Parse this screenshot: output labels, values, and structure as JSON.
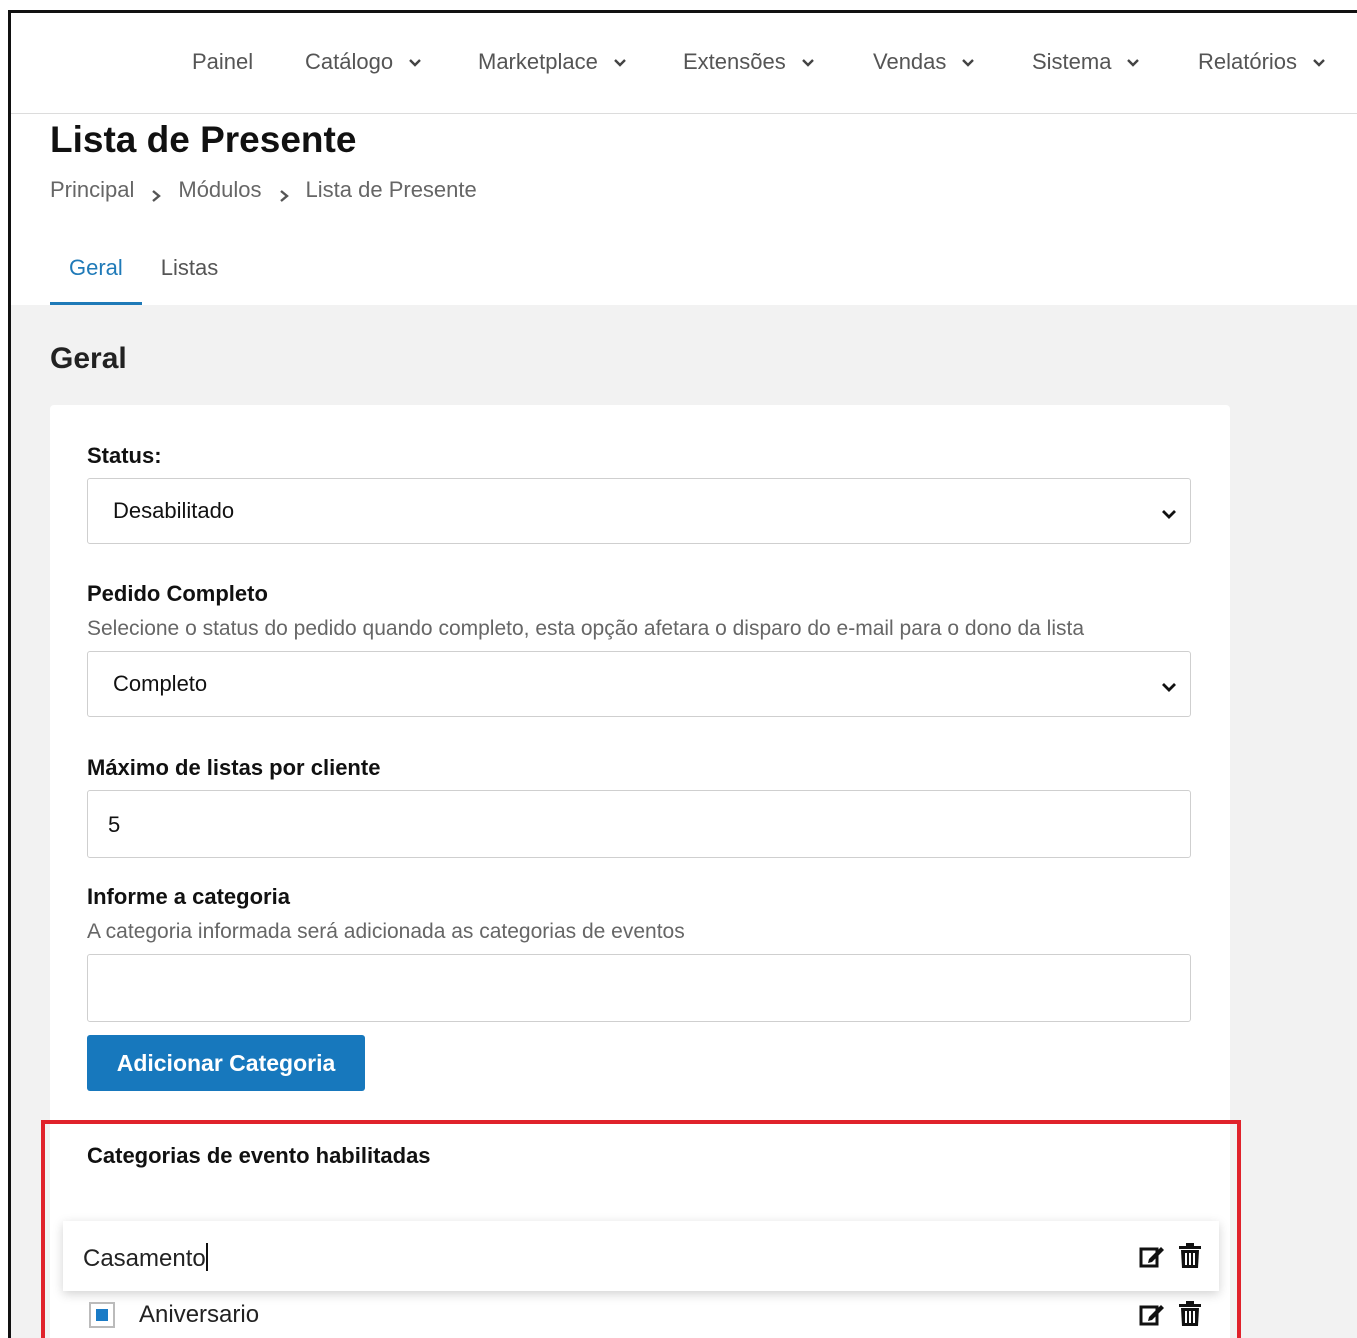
{
  "nav": {
    "items": [
      {
        "label": "Painel",
        "dropdown": false
      },
      {
        "label": "Catálogo",
        "dropdown": true
      },
      {
        "label": "Marketplace",
        "dropdown": true
      },
      {
        "label": "Extensões",
        "dropdown": true
      },
      {
        "label": "Vendas",
        "dropdown": true
      },
      {
        "label": "Sistema",
        "dropdown": true
      },
      {
        "label": "Relatórios",
        "dropdown": true
      }
    ]
  },
  "header": {
    "title": "Lista de Presente",
    "breadcrumb": [
      "Principal",
      "Módulos",
      "Lista de Presente"
    ]
  },
  "tabs": [
    {
      "label": "Geral",
      "active": true
    },
    {
      "label": "Listas",
      "active": false
    }
  ],
  "section": {
    "title": "Geral"
  },
  "form": {
    "status": {
      "label": "Status:",
      "value": "Desabilitado"
    },
    "pedido_completo": {
      "label": "Pedido Completo",
      "help": "Selecione o status do pedido quando completo, esta opção afetara o disparo do e-mail para o dono da lista",
      "value": "Completo"
    },
    "max_listas": {
      "label": "Máximo de listas por cliente",
      "value": "5"
    },
    "categoria": {
      "label": "Informe a categoria",
      "help": "A categoria informada será adicionada as categorias de eventos",
      "value": ""
    },
    "add_button": "Adicionar Categoria"
  },
  "categories": {
    "title": "Categorias de evento habilitadas",
    "editing": {
      "value": "Casamento"
    },
    "items": [
      {
        "label": "Aniversario",
        "checked": true
      }
    ]
  },
  "colors": {
    "accent": "#1f7ab8",
    "button": "#1778bd",
    "highlight": "#e0222b",
    "checkbox": "#1a7bc6"
  }
}
